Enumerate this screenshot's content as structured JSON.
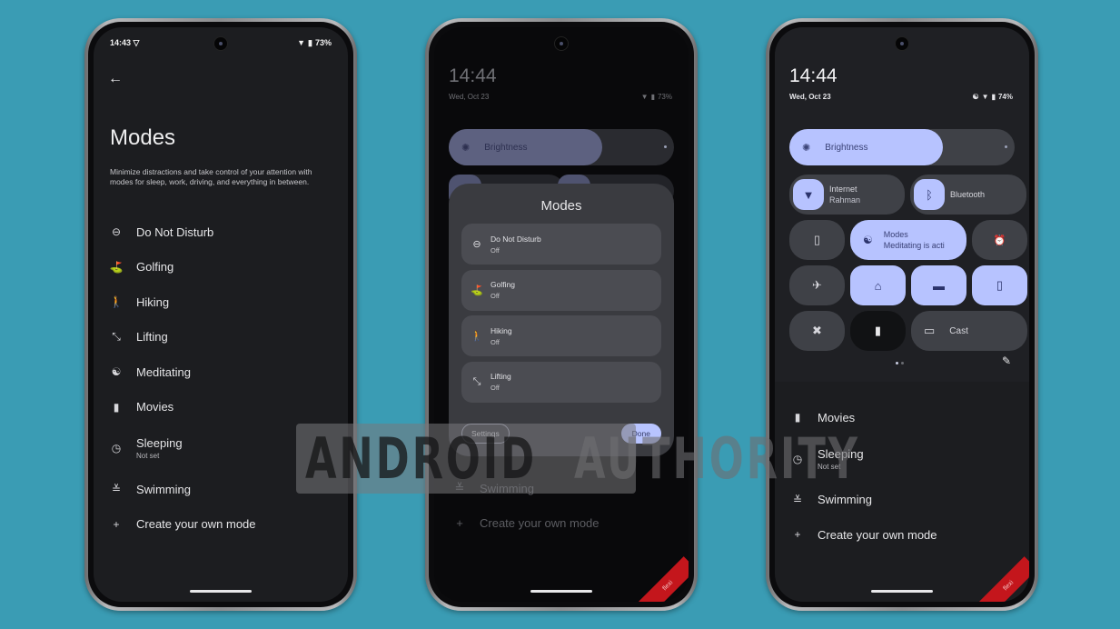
{
  "phone1": {
    "status_time": "14:43",
    "status_battery": "73%",
    "icons": {
      "back": "arrow-back-icon"
    },
    "title": "Modes",
    "description": "Minimize distractions and take control of your attention with modes for sleep, work, driving, and everything in between.",
    "modes": [
      {
        "label": "Do Not Disturb",
        "sub": "",
        "icon": "⊖",
        "icon_name": "do-not-disturb-icon"
      },
      {
        "label": "Golfing",
        "sub": "",
        "icon": "⛳",
        "icon_name": "golf-icon"
      },
      {
        "label": "Hiking",
        "sub": "",
        "icon": "🚶",
        "icon_name": "hiking-icon"
      },
      {
        "label": "Lifting",
        "sub": "",
        "icon": "⤡",
        "icon_name": "dumbbell-icon"
      },
      {
        "label": "Meditating",
        "sub": "",
        "icon": "☯",
        "icon_name": "meditation-icon"
      },
      {
        "label": "Movies",
        "sub": "",
        "icon": "▮",
        "icon_name": "movie-icon"
      },
      {
        "label": "Sleeping",
        "sub": "Not set",
        "icon": "◷",
        "icon_name": "clock-icon"
      },
      {
        "label": "Swimming",
        "sub": "",
        "icon": "≚",
        "icon_name": "swimming-icon"
      },
      {
        "label": "Create your own mode",
        "sub": "",
        "icon": "+",
        "icon_name": "plus-icon"
      }
    ]
  },
  "phone2": {
    "clock": "14:44",
    "date": "Wed, Oct 23",
    "battery": "73%",
    "brightness_label": "Brightness",
    "brightness_level": 0.68,
    "dialog": {
      "title": "Modes",
      "items": [
        {
          "label": "Do Not Disturb",
          "status": "Off",
          "icon": "⊖"
        },
        {
          "label": "Golfing",
          "status": "Off",
          "icon": "⛳"
        },
        {
          "label": "Hiking",
          "status": "Off",
          "icon": "🚶"
        },
        {
          "label": "Lifting",
          "status": "Off",
          "icon": "⤡"
        }
      ],
      "settings_label": "Settings",
      "done_label": "Done"
    },
    "background_items": [
      {
        "label": "Swimming",
        "icon": "≚"
      },
      {
        "label": "Create your own mode",
        "icon": "+"
      }
    ]
  },
  "phone3": {
    "clock": "14:44",
    "date": "Wed, Oct 23",
    "battery": "74%",
    "brightness_label": "Brightness",
    "brightness_level": 0.68,
    "tiles": {
      "internet": {
        "label": "Internet",
        "sub": "Rahman",
        "icon": "▼"
      },
      "bluetooth": {
        "label": "Bluetooth",
        "icon": "ᛒ"
      },
      "flashlight": {
        "icon": "▯"
      },
      "modes": {
        "label": "Modes",
        "sub": "Meditating is acti",
        "icon": "☯"
      },
      "alarm": {
        "icon": "⏰"
      },
      "airplane": {
        "icon": "✈"
      },
      "home": {
        "icon": "⌂"
      },
      "wallet": {
        "icon": "▬"
      },
      "rotate": {
        "icon": "▯"
      },
      "cross": {
        "icon": "✖"
      },
      "battery_saver": {
        "icon": "▮"
      },
      "cast": {
        "label": "Cast",
        "icon": "▭"
      }
    },
    "edit_icon": "✎",
    "list": [
      {
        "label": "Movies",
        "sub": "",
        "icon": "▮"
      },
      {
        "label": "Sleeping",
        "sub": "Not set",
        "icon": "◷"
      },
      {
        "label": "Swimming",
        "sub": "",
        "icon": "≚"
      },
      {
        "label": "Create your own mode",
        "sub": "",
        "icon": "+"
      }
    ]
  },
  "watermark": {
    "word1": "ANDROID",
    "word2": "AUTHORITY"
  },
  "badge": "flexi"
}
